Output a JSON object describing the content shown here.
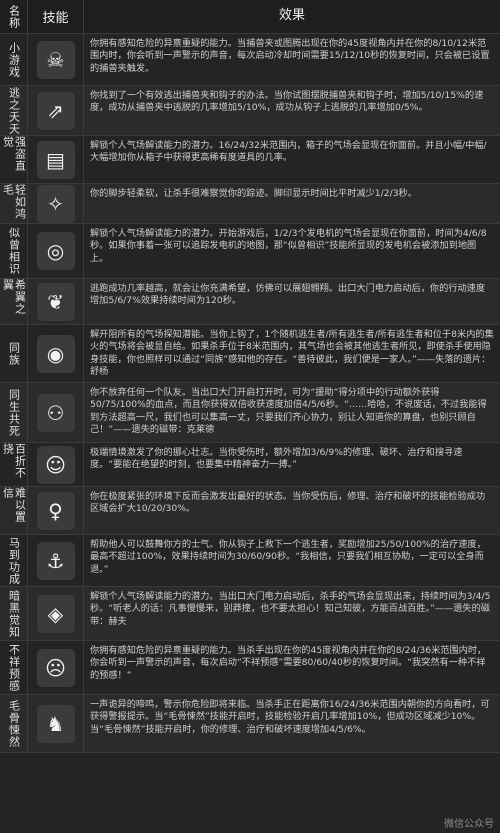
{
  "header": {
    "name": "名称",
    "icon": "技能",
    "effect": "效果"
  },
  "rows": [
    {
      "name": "小游戏",
      "icon": "trap-jaw-icon",
      "glyph": "☠",
      "h": 52,
      "text": "你拥有感知危险的异禀重疑的能力。当捕兽夹或图腾出现在你的45度视角内并在你的8/10/12米范围内时，你会听到一声警示的声音，每次启动冷却时间需要15/12/10秒的恢复时间，只会被已设置的捕兽夹触发。"
    },
    {
      "name": "逃之夭夭",
      "icon": "escape-icon",
      "glyph": "⇗",
      "h": 50,
      "text": "你找到了一个有效逃出捕兽夹和钩子的办法。当你试图摆脱捕兽夹和钩子时，增加5/10/15%的速度，成功从捕兽夹中逃脱的几率增加5/10%，成功从钩子上逃脱的几率增加0/5%。"
    },
    {
      "name": "强盗直觉",
      "icon": "chest-icon",
      "glyph": "▤",
      "h": 48,
      "text": "解锁个人气场解读能力的潜力。16/24/32米范围内，箱子的气场会显现在你面前。并且小幅/中幅/大幅增加你从箱子中获得更高稀有度道具的几率。"
    },
    {
      "name": "轻如鸿毛",
      "icon": "feather-icon",
      "glyph": "✧",
      "h": 40,
      "text": "你的脚步轻柔软，让杀手很难察觉你的踪迹。脚印显示时间比平时减少1/2/3秒。"
    },
    {
      "name": "似曾相识",
      "icon": "eye-spiral-icon",
      "glyph": "◎",
      "h": 55,
      "text": "解锁个人气场解读能力的潜力。开始游戏后，1/2/3个发电机的气场会显现在你面前，时间为4/6/8秒。如果你事着一张可以追踪发电机的地图，那“似曾相识”技能所显现的发电机会被添加到地图上。"
    },
    {
      "name": "希翼之翼",
      "icon": "wings-icon",
      "glyph": "❦",
      "h": 46,
      "text": "逃跑成功几率越高，就会让你充满希望，仿佛可以展翅翱翔。出口大门电力启动后，你的行动速度增加5/6/7%效果持续时间为120秒。"
    },
    {
      "name": "同族",
      "icon": "crying-eye-icon",
      "glyph": "◉",
      "h": 58,
      "text": "解开阻所有的气场探知潜能。当你上钩了，1个随机逃生者/所有逃生者/所有逃生者和位于8米内的集火的气场将会被显自给。如果杀手位于8米范围内，其气场也会被其他逃生者所见，即使杀手使用隐身技能，你也照样可以通过“同族”感知他的存在。“善待彼此，我们便是一家人。”——失落的遗片：舒杨"
    },
    {
      "name": "同生共死",
      "icon": "figures-icon",
      "glyph": "⚇",
      "h": 60,
      "text": "你不放弃任何一个队友。当出口大门开启打开时，可为“援助”得分项中的行动额外获得50/75/100%的血点，而且你获得双倍收获速度加倍4/5/6秒。“……哈哈，不说废话，不过我能得到方法超高一尺，我们也可以集高一丈，只要我们齐心协力，别让人知道你的算盘，也别只顾自己！”——遗失的磁带：克莱德"
    },
    {
      "name": "百折不挠",
      "icon": "bald-head-icon",
      "glyph": "☺",
      "h": 44,
      "text": "极端情境激发了你的挪心壮志。当你受伤时，额外增加3/6/9%的修理、破坏、治疗和搜寻速度。“要能在绝望的时刻，也要集中精神奋力一搏。”"
    },
    {
      "name": "难以置信",
      "icon": "woman-portrait-icon",
      "glyph": "♀",
      "h": 48,
      "text": "你在极度紧张的环境下反而会激发出最好的状态。当你受伤后，修理、治疗和破坏的技能检验成功区域会扩大10/20/30%。"
    },
    {
      "name": "马到功成",
      "icon": "hook-man-icon",
      "glyph": "⚓",
      "h": 52,
      "text": "帮助他人可以鼓舞你方的士气。你从钩子上救下一个逃生者，奖励增加25/50/100%的治疗速度，最高不超过100%，效果持续时间为30/60/90秒。“我相信，只要我们相互协助，一定可以全身而退。”"
    },
    {
      "name": "暗黑觉知",
      "icon": "dark-eye-icon",
      "glyph": "◈",
      "h": 54,
      "text": "解锁个人气场解读能力的潜力。当出口大门电力启动后，杀手的气场会显现出来，持续时间为3/4/5秒。“听老人的话：凡事慢慢来，别莽撞，也不要太担心！知己知彼，方能百战百胜。”——遗失的磁带：赫夫"
    },
    {
      "name": "不祥预感",
      "icon": "scared-face-icon",
      "glyph": "☹",
      "h": 54,
      "text": "你拥有感知危险的异禀重疑的能力。当杀手出现在你的45度视角内并在你的8/24/36米范围内时，你会听到一声警示的声音，每次启动“不祥预感”需要80/60/40秒的恢复时间。“我突然有一种不祥的预感！”"
    },
    {
      "name": "毛骨悚然",
      "icon": "cat-icon",
      "glyph": "♞",
      "h": 58,
      "text": "一声诡异的啼鸣，警示你危险即将来临。当杀手正在距离你16/24/36米范围内朝你的方向看时，可获得警报提示。当“毛骨悚然”技能开启时，技能检验开启几率增加10%，但成功区域减少10%。当“毛骨悚然”技能开启时，你的修理、治疗和破坏速度增加4/5/6%。"
    }
  ],
  "watermark": "微信公众号"
}
